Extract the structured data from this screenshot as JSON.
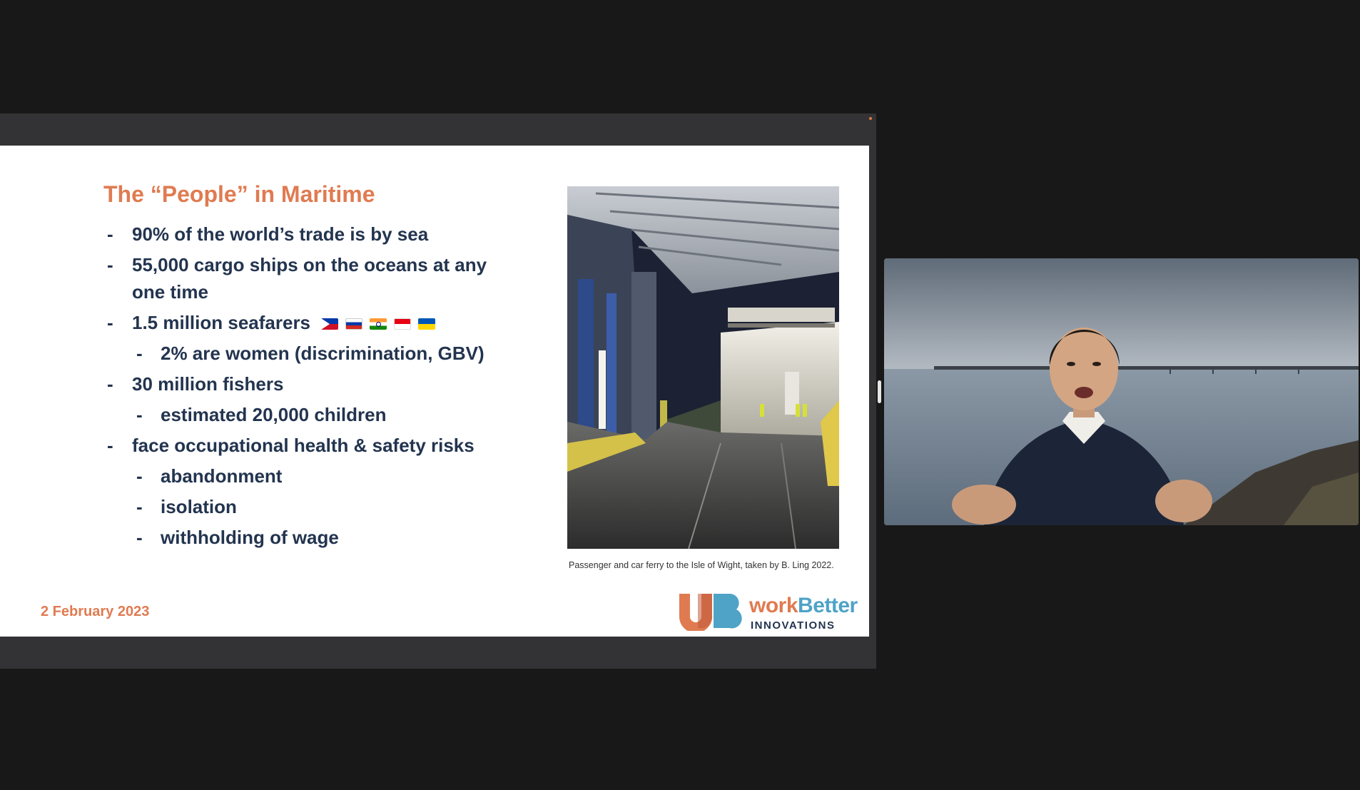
{
  "slide": {
    "title": "The “People” in Maritime",
    "bullets": [
      {
        "level": 1,
        "text": "90% of the world’s trade is by sea"
      },
      {
        "level": 1,
        "text": "55,000 cargo ships on the oceans at any one time"
      },
      {
        "level": 1,
        "text": "1.5 million seafarers"
      },
      {
        "level": 2,
        "text": "2% are women (discrimination, GBV)"
      },
      {
        "level": 1,
        "text": "30 million fishers"
      },
      {
        "level": 2,
        "text": "estimated 20,000 children"
      },
      {
        "level": 1,
        "text": "face occupational health & safety risks"
      },
      {
        "level": 2,
        "text": "abandonment"
      },
      {
        "level": 2,
        "text": "isolation"
      },
      {
        "level": 2,
        "text": "withholding of wage"
      }
    ],
    "dash": "-",
    "flags": [
      "flag-philippines-icon",
      "flag-russia-icon",
      "flag-india-icon",
      "flag-indonesia-icon",
      "flag-ukraine-icon"
    ],
    "photo_caption": "Passenger and car ferry to the Isle of Wight, taken by B. Ling 2022.",
    "date": "2 February 2023",
    "logo": {
      "word_a": "work",
      "word_b": "Better",
      "sub": "INNOVATIONS"
    }
  },
  "colors": {
    "title": "#e07b51",
    "body_text": "#23344f",
    "logo_blue": "#4ea3c7",
    "background": "#181818",
    "share_frame": "#333335"
  }
}
